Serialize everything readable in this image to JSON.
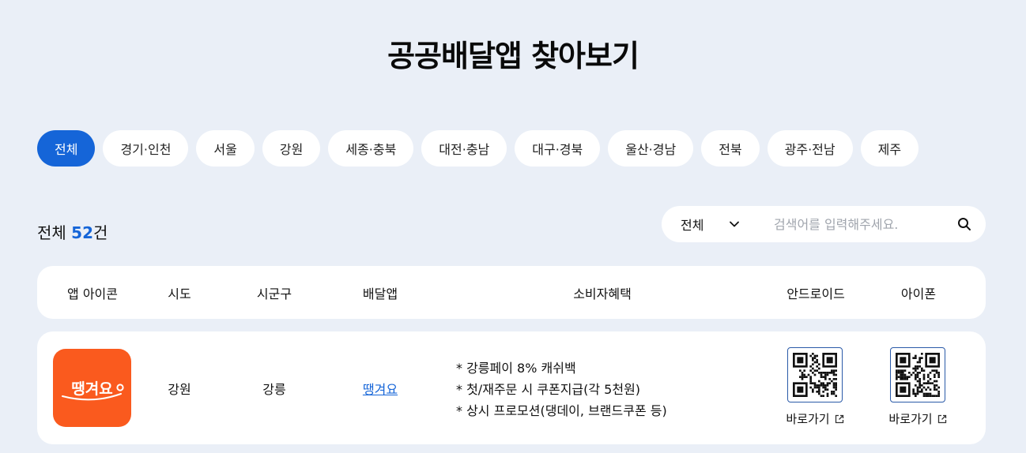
{
  "title": "공공배달앱 찾아보기",
  "regions": [
    "전체",
    "경기·인천",
    "서울",
    "강원",
    "세종·충북",
    "대전·충남",
    "대구·경북",
    "울산·경남",
    "전북",
    "광주·전남",
    "제주"
  ],
  "active_region": "전체",
  "count": {
    "prefix": "전체",
    "number": "52",
    "suffix": "건"
  },
  "search": {
    "select_value": "전체",
    "placeholder": "검색어를 입력해주세요."
  },
  "columns": [
    "앱 아이콘",
    "시도",
    "시군구",
    "배달앱",
    "소비자혜택",
    "안드로이드",
    "아이폰"
  ],
  "rows": [
    {
      "app_icon_text": "땡겨요",
      "sido": "강원",
      "sigungu": "강릉",
      "app_name": "땡겨요",
      "benefits": [
        "* 강릉페이 8% 캐쉬백",
        "* 첫/재주문 시 쿠폰지급(각 5천원)",
        "* 상시 프로모션(댕데이, 브랜드쿠폰 등)"
      ],
      "android_link": "바로가기",
      "ios_link": "바로가기"
    }
  ],
  "colors": {
    "accent": "#1565d8",
    "background": "#eaeff7",
    "app_icon_bg": "#fa5a1e"
  }
}
